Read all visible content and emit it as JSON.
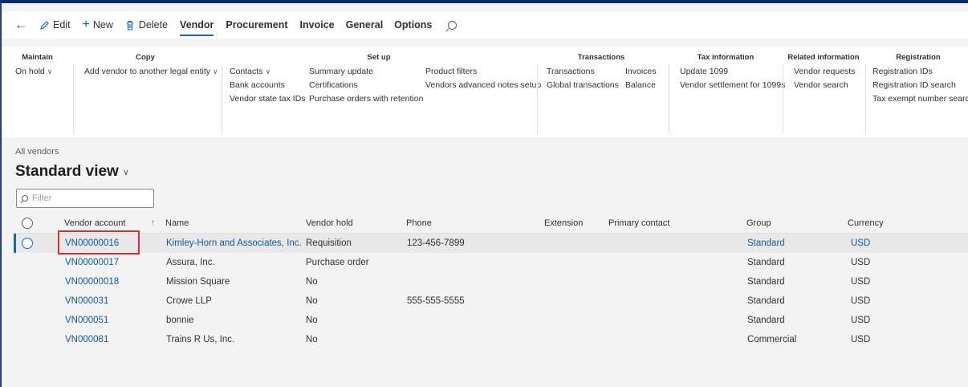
{
  "tabstrip": {
    "back_glyph": "←",
    "edit": {
      "icon": "pencil-icon",
      "label": "Edit"
    },
    "new": {
      "icon": "plus-icon",
      "label": "New"
    },
    "delete": {
      "icon": "trash-icon",
      "label": "Delete"
    },
    "tabs": [
      "Vendor",
      "Procurement",
      "Invoice",
      "General",
      "Options"
    ],
    "active_tab": "Vendor"
  },
  "ribbon": {
    "maintain": {
      "title": "Maintain",
      "items": [
        "On hold"
      ]
    },
    "copy": {
      "title": "Copy",
      "items": [
        "Add vendor to another legal entity"
      ]
    },
    "setup": {
      "title": "Set up",
      "col1": [
        "Contacts",
        "Bank accounts",
        "Vendor state tax IDs"
      ],
      "col2": [
        "Summary update",
        "Certifications",
        "Purchase orders with retention"
      ],
      "col3": [
        "Product filters",
        "Vendors advanced notes setup"
      ]
    },
    "transactions": {
      "title": "Transactions",
      "col1": [
        "Transactions",
        "Global transactions"
      ],
      "col2": [
        "Invoices",
        "Balance"
      ]
    },
    "tax": {
      "title": "Tax information",
      "items": [
        "Update 1099",
        "Vendor settlement for 1099s"
      ]
    },
    "related": {
      "title": "Related information",
      "items": [
        "Vendor requests",
        "Vendor search"
      ]
    },
    "registration": {
      "title": "Registration",
      "items": [
        "Registration IDs",
        "Registration ID search",
        "Tax exempt number search"
      ]
    }
  },
  "page": {
    "breadcrumb": "All vendors",
    "view_title": "Standard view",
    "filter_placeholder": "Filter"
  },
  "grid": {
    "headers": [
      "Vendor account",
      "Name",
      "Vendor hold",
      "Phone",
      "Extension",
      "Primary contact",
      "Group",
      "Currency"
    ],
    "sort_arrow": "↑",
    "rows": [
      {
        "account": "VN00000016",
        "name": "Kimley-Horn and Associates, Inc.",
        "hold": "Requisition",
        "phone": "123-456-7899",
        "extension": "",
        "contact": "",
        "group": "Standard",
        "currency": "USD"
      },
      {
        "account": "VN00000017",
        "name": "Assura, Inc.",
        "hold": "Purchase order",
        "phone": "",
        "extension": "",
        "contact": "",
        "group": "Standard",
        "currency": "USD"
      },
      {
        "account": "VN00000018",
        "name": "Mission Square",
        "hold": "No",
        "phone": "",
        "extension": "",
        "contact": "",
        "group": "Standard",
        "currency": "USD"
      },
      {
        "account": "VN000031",
        "name": "Crowe LLP",
        "hold": "No",
        "phone": "555-555-5555",
        "extension": "",
        "contact": "",
        "group": "Standard",
        "currency": "USD"
      },
      {
        "account": "VN000051",
        "name": "bonnie",
        "hold": "No",
        "phone": "",
        "extension": "",
        "contact": "",
        "group": "Standard",
        "currency": "USD"
      },
      {
        "account": "VN000081",
        "name": "Trains R Us, Inc.",
        "hold": "No",
        "phone": "",
        "extension": "",
        "contact": "",
        "group": "Commercial",
        "currency": "USD"
      }
    ]
  },
  "colors": {
    "accent": "#0f6cbd",
    "link": "#0f5cad",
    "highlight": "#d13438",
    "top_bar": "#0a2a6b"
  }
}
